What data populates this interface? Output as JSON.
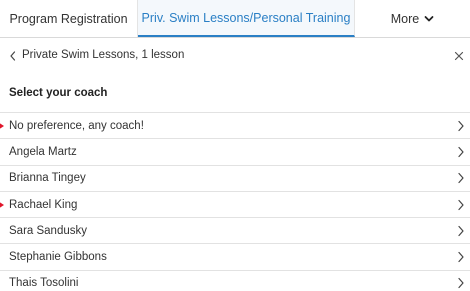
{
  "tabs": [
    {
      "label": "Program Registration",
      "active": false
    },
    {
      "label": "Priv. Swim Lessons/Personal Training",
      "active": true
    },
    {
      "label": "More",
      "active": false
    }
  ],
  "header": {
    "title": "Private Swim Lessons, 1 lesson"
  },
  "section": {
    "title": "Select your coach"
  },
  "coaches": [
    {
      "label": "No preference, any coach!",
      "marked": true
    },
    {
      "label": "Angela Martz",
      "marked": false
    },
    {
      "label": "Brianna Tingey",
      "marked": false
    },
    {
      "label": "Rachael King",
      "marked": true
    },
    {
      "label": "Sara Sandusky",
      "marked": false
    },
    {
      "label": "Stephanie Gibbons",
      "marked": false
    },
    {
      "label": "Thais Tosolini",
      "marked": false
    }
  ],
  "colors": {
    "accent": "#2a7fc5",
    "marker": "#e0162b"
  },
  "icons": {
    "back": "chevron-left-icon",
    "close": "close-icon",
    "more": "chevron-down-icon",
    "row": "chevron-right-icon"
  }
}
